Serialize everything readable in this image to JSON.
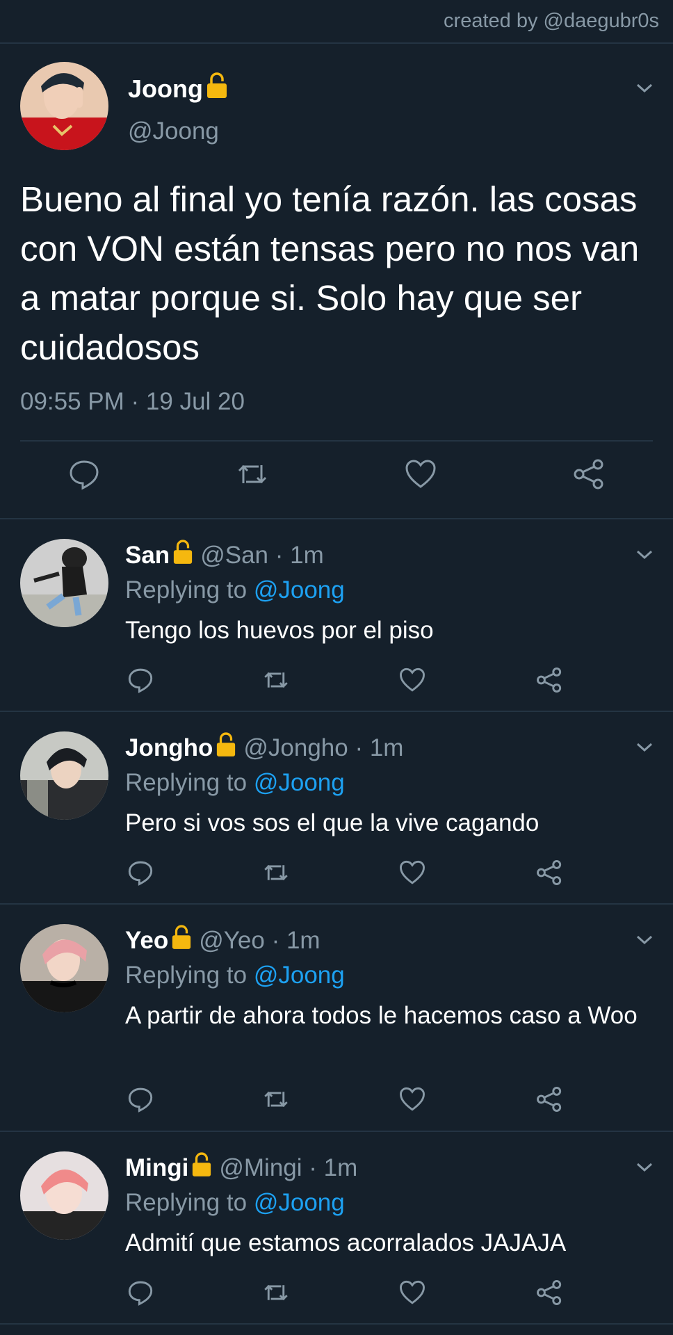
{
  "credit": "created by @daegubr0s",
  "colors": {
    "background": "#15202b",
    "secondary_text": "#8899a6",
    "link": "#1da1f2",
    "divider": "#243443",
    "lock": "#f5b80f"
  },
  "tweet": {
    "name": "Joong",
    "handle": "@Joong",
    "text": "Bueno al final yo tenía razón. las cosas con VON están tensas pero no nos van a matar porque si. Solo hay que ser cuidadosos",
    "timestamp": "09:55 PM · 19 Jul 20",
    "icons": [
      "reply-icon",
      "retweet-icon",
      "like-icon",
      "share-icon"
    ]
  },
  "replies": [
    {
      "name": "San",
      "handle": "@San · 1m",
      "replying_prefix": "Replying to ",
      "replying_to": "@Joong",
      "text": "Tengo los huevos por el piso"
    },
    {
      "name": "Jongho",
      "handle": "@Jongho · 1m",
      "replying_prefix": "Replying to ",
      "replying_to": "@Joong",
      "text": "Pero si vos sos el que la vive cagando"
    },
    {
      "name": "Yeo",
      "handle": "@Yeo · 1m",
      "replying_prefix": "Replying to ",
      "replying_to": "@Joong",
      "text": "A partir de ahora todos le hacemos caso a Woo"
    },
    {
      "name": "Mingi",
      "handle": "@Mingi · 1m",
      "replying_prefix": "Replying to ",
      "replying_to": "@Joong",
      "text": "Admití que estamos acorralados JAJAJA"
    }
  ]
}
